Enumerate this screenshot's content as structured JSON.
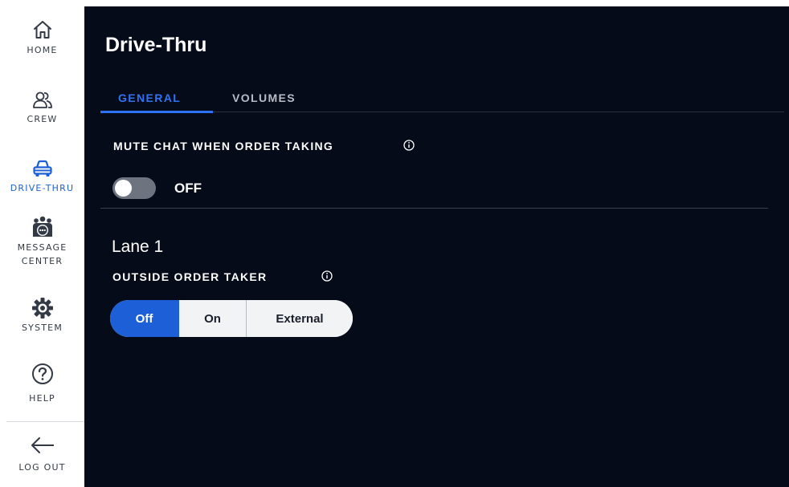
{
  "sidebar": {
    "items": [
      {
        "label": "HOME",
        "icon": "home-icon"
      },
      {
        "label": "CREW",
        "icon": "crew-icon"
      },
      {
        "label": "DRIVE-THRU",
        "icon": "car-icon",
        "active": true
      },
      {
        "label": "MESSAGE\nCENTER",
        "icon": "message-center-icon"
      },
      {
        "label": "SYSTEM",
        "icon": "gear-icon"
      },
      {
        "label": "HELP",
        "icon": "help-icon"
      },
      {
        "label": "LOG OUT",
        "icon": "arrow-left-icon"
      }
    ]
  },
  "header": {
    "title": "Drive-Thru"
  },
  "tabs": [
    {
      "label": "GENERAL",
      "active": true
    },
    {
      "label": "VOLUMES",
      "active": false
    }
  ],
  "general": {
    "mute_chat": {
      "label": "MUTE CHAT WHEN ORDER TAKING",
      "state": "OFF"
    },
    "lane": {
      "title": "Lane 1",
      "outside_order_taker": {
        "label": "OUTSIDE ORDER TAKER",
        "options": [
          "Off",
          "On",
          "External"
        ],
        "selected": "Off"
      }
    }
  },
  "colors": {
    "accent": "#1c5fd6",
    "tab_accent": "#2f73f5",
    "main_bg": "#060b19",
    "sidebar_bg": "#ffffff"
  }
}
